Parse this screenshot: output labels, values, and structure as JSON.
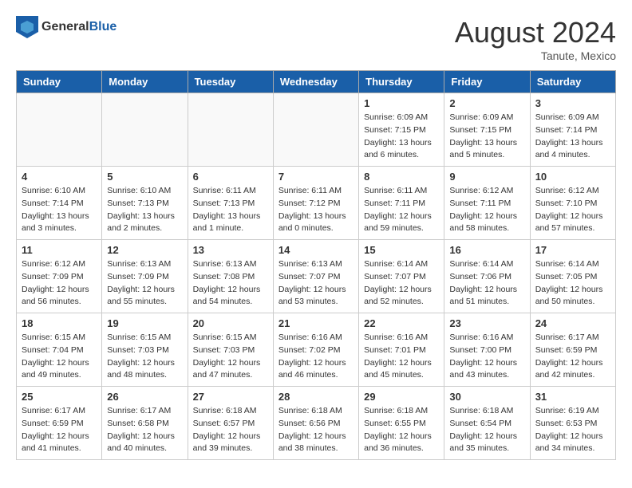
{
  "header": {
    "logo_general": "General",
    "logo_blue": "Blue",
    "title": "August 2024",
    "location": "Tanute, Mexico"
  },
  "days_of_week": [
    "Sunday",
    "Monday",
    "Tuesday",
    "Wednesday",
    "Thursday",
    "Friday",
    "Saturday"
  ],
  "weeks": [
    [
      {
        "day": "",
        "info": ""
      },
      {
        "day": "",
        "info": ""
      },
      {
        "day": "",
        "info": ""
      },
      {
        "day": "",
        "info": ""
      },
      {
        "day": "1",
        "info": "Sunrise: 6:09 AM\nSunset: 7:15 PM\nDaylight: 13 hours\nand 6 minutes."
      },
      {
        "day": "2",
        "info": "Sunrise: 6:09 AM\nSunset: 7:15 PM\nDaylight: 13 hours\nand 5 minutes."
      },
      {
        "day": "3",
        "info": "Sunrise: 6:09 AM\nSunset: 7:14 PM\nDaylight: 13 hours\nand 4 minutes."
      }
    ],
    [
      {
        "day": "4",
        "info": "Sunrise: 6:10 AM\nSunset: 7:14 PM\nDaylight: 13 hours\nand 3 minutes."
      },
      {
        "day": "5",
        "info": "Sunrise: 6:10 AM\nSunset: 7:13 PM\nDaylight: 13 hours\nand 2 minutes."
      },
      {
        "day": "6",
        "info": "Sunrise: 6:11 AM\nSunset: 7:13 PM\nDaylight: 13 hours\nand 1 minute."
      },
      {
        "day": "7",
        "info": "Sunrise: 6:11 AM\nSunset: 7:12 PM\nDaylight: 13 hours\nand 0 minutes."
      },
      {
        "day": "8",
        "info": "Sunrise: 6:11 AM\nSunset: 7:11 PM\nDaylight: 12 hours\nand 59 minutes."
      },
      {
        "day": "9",
        "info": "Sunrise: 6:12 AM\nSunset: 7:11 PM\nDaylight: 12 hours\nand 58 minutes."
      },
      {
        "day": "10",
        "info": "Sunrise: 6:12 AM\nSunset: 7:10 PM\nDaylight: 12 hours\nand 57 minutes."
      }
    ],
    [
      {
        "day": "11",
        "info": "Sunrise: 6:12 AM\nSunset: 7:09 PM\nDaylight: 12 hours\nand 56 minutes."
      },
      {
        "day": "12",
        "info": "Sunrise: 6:13 AM\nSunset: 7:09 PM\nDaylight: 12 hours\nand 55 minutes."
      },
      {
        "day": "13",
        "info": "Sunrise: 6:13 AM\nSunset: 7:08 PM\nDaylight: 12 hours\nand 54 minutes."
      },
      {
        "day": "14",
        "info": "Sunrise: 6:13 AM\nSunset: 7:07 PM\nDaylight: 12 hours\nand 53 minutes."
      },
      {
        "day": "15",
        "info": "Sunrise: 6:14 AM\nSunset: 7:07 PM\nDaylight: 12 hours\nand 52 minutes."
      },
      {
        "day": "16",
        "info": "Sunrise: 6:14 AM\nSunset: 7:06 PM\nDaylight: 12 hours\nand 51 minutes."
      },
      {
        "day": "17",
        "info": "Sunrise: 6:14 AM\nSunset: 7:05 PM\nDaylight: 12 hours\nand 50 minutes."
      }
    ],
    [
      {
        "day": "18",
        "info": "Sunrise: 6:15 AM\nSunset: 7:04 PM\nDaylight: 12 hours\nand 49 minutes."
      },
      {
        "day": "19",
        "info": "Sunrise: 6:15 AM\nSunset: 7:03 PM\nDaylight: 12 hours\nand 48 minutes."
      },
      {
        "day": "20",
        "info": "Sunrise: 6:15 AM\nSunset: 7:03 PM\nDaylight: 12 hours\nand 47 minutes."
      },
      {
        "day": "21",
        "info": "Sunrise: 6:16 AM\nSunset: 7:02 PM\nDaylight: 12 hours\nand 46 minutes."
      },
      {
        "day": "22",
        "info": "Sunrise: 6:16 AM\nSunset: 7:01 PM\nDaylight: 12 hours\nand 45 minutes."
      },
      {
        "day": "23",
        "info": "Sunrise: 6:16 AM\nSunset: 7:00 PM\nDaylight: 12 hours\nand 43 minutes."
      },
      {
        "day": "24",
        "info": "Sunrise: 6:17 AM\nSunset: 6:59 PM\nDaylight: 12 hours\nand 42 minutes."
      }
    ],
    [
      {
        "day": "25",
        "info": "Sunrise: 6:17 AM\nSunset: 6:59 PM\nDaylight: 12 hours\nand 41 minutes."
      },
      {
        "day": "26",
        "info": "Sunrise: 6:17 AM\nSunset: 6:58 PM\nDaylight: 12 hours\nand 40 minutes."
      },
      {
        "day": "27",
        "info": "Sunrise: 6:18 AM\nSunset: 6:57 PM\nDaylight: 12 hours\nand 39 minutes."
      },
      {
        "day": "28",
        "info": "Sunrise: 6:18 AM\nSunset: 6:56 PM\nDaylight: 12 hours\nand 38 minutes."
      },
      {
        "day": "29",
        "info": "Sunrise: 6:18 AM\nSunset: 6:55 PM\nDaylight: 12 hours\nand 36 minutes."
      },
      {
        "day": "30",
        "info": "Sunrise: 6:18 AM\nSunset: 6:54 PM\nDaylight: 12 hours\nand 35 minutes."
      },
      {
        "day": "31",
        "info": "Sunrise: 6:19 AM\nSunset: 6:53 PM\nDaylight: 12 hours\nand 34 minutes."
      }
    ]
  ]
}
